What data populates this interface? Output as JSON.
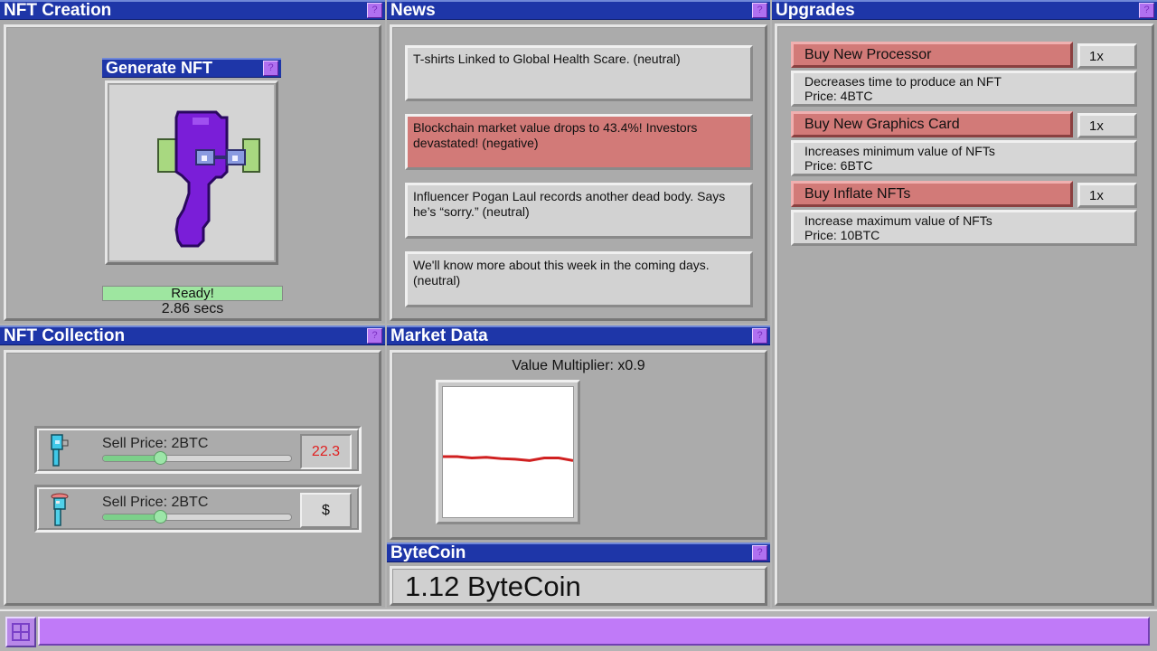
{
  "nft_creation": {
    "title": "NFT Creation",
    "help": "?",
    "generate_title": "Generate NFT",
    "status": "Ready!",
    "progress": 1.0,
    "time": "2.86 secs"
  },
  "news": {
    "title": "News",
    "help": "?",
    "items": [
      {
        "text": "T-shirts Linked to Global Health Scare. (neutral)",
        "sentiment": "neutral"
      },
      {
        "text": "Blockchain market value drops to 43.4%! Investors devastated! (negative)",
        "sentiment": "negative"
      },
      {
        "text": "Influencer Pogan Laul records another dead body. Says he’s “sorry.” (neutral)",
        "sentiment": "neutral"
      },
      {
        "text": "We'll know more about this week in the coming days. (neutral)",
        "sentiment": "neutral"
      }
    ]
  },
  "upgrades": {
    "title": "Upgrades",
    "help": "?",
    "items": [
      {
        "label": "Buy New Processor",
        "qty": "1x",
        "desc": "Decreases time to produce an NFT",
        "price": "Price: 4BTC"
      },
      {
        "label": "Buy New Graphics Card",
        "qty": "1x",
        "desc": "Increases minimum value of NFTs",
        "price": "Price: 6BTC"
      },
      {
        "label": "Buy Inflate NFTs",
        "qty": "1x",
        "desc": "Increase maximum value of NFTs",
        "price": "Price: 10BTC"
      }
    ]
  },
  "collection": {
    "title": "NFT Collection",
    "help": "?",
    "items": [
      {
        "sell_label": "Sell Price: 2BTC",
        "slider": 0.3,
        "action": "22.3",
        "action_color": "#e02020"
      },
      {
        "sell_label": "Sell Price: 2BTC",
        "slider": 0.3,
        "action": "$",
        "action_color": "#111111"
      }
    ]
  },
  "market": {
    "title": "Market Data",
    "help": "?",
    "multiplier": "Value Multiplier: x0.9"
  },
  "chart_data": {
    "type": "line",
    "x": [
      0,
      1,
      2,
      3,
      4,
      5,
      6,
      7,
      8,
      9
    ],
    "series": [
      {
        "values": [
          0.93,
          0.93,
          0.91,
          0.92,
          0.9,
          0.89,
          0.87,
          0.91,
          0.91,
          0.87
        ],
        "color": "#d02020"
      }
    ],
    "ylim": [
      0.0,
      2.0
    ],
    "grid": false,
    "title": "",
    "xlabel": "",
    "ylabel": ""
  },
  "bytecoin": {
    "title": "ByteCoin",
    "help": "?",
    "balance": "1.12 ByteCoin"
  },
  "taskbar": {
    "accent": "#c07af8",
    "start_icon": "grid-icon"
  }
}
